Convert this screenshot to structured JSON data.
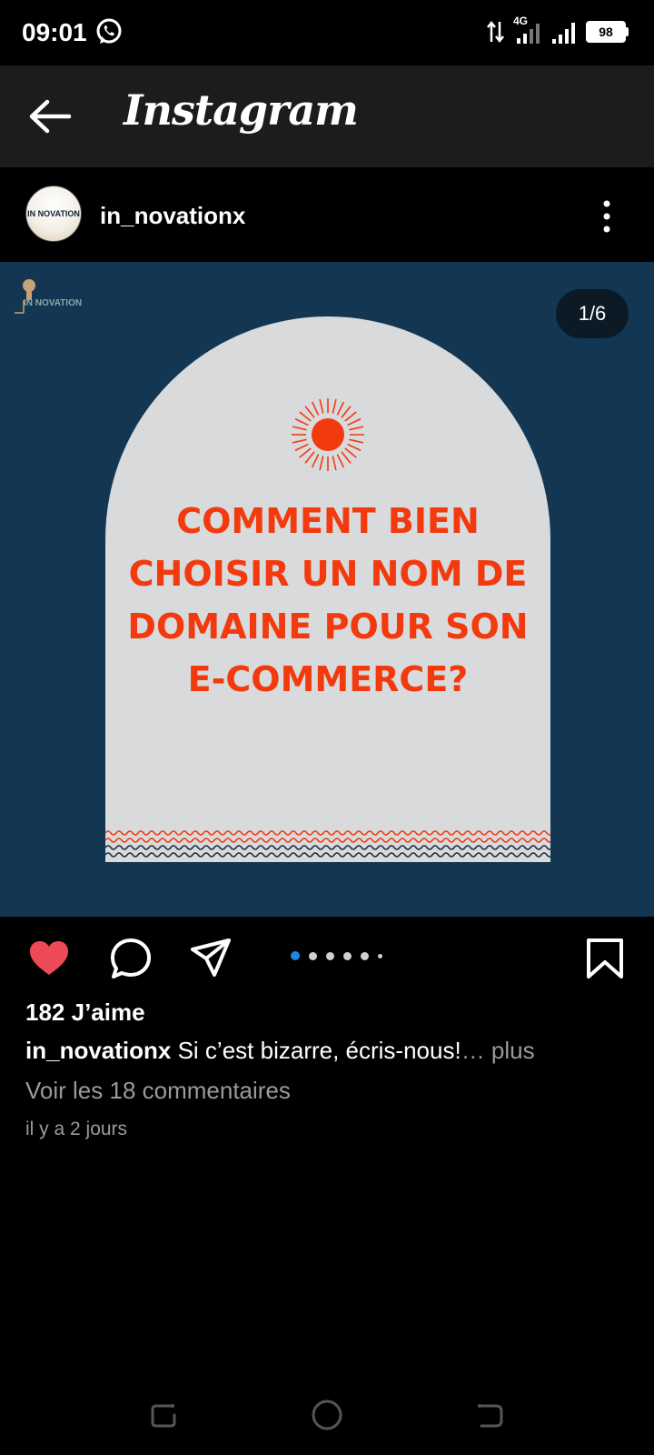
{
  "status_bar": {
    "time": "09:01",
    "network": "4G",
    "battery": "98",
    "icons": [
      "whatsapp-icon",
      "data-arrows-icon",
      "signal-icon",
      "signal-icon",
      "battery-icon"
    ]
  },
  "app_bar": {
    "title": "Instagram",
    "back_icon": "arrow-left-icon"
  },
  "post": {
    "username": "in_novationx",
    "avatar_text": "IN NOVATION",
    "image": {
      "logo_text": "IN NOVATION",
      "counter": "1/6",
      "headline": "COMMENT BIEN CHOISIR UN NOM DE DOMAINE POUR SON E-COMMERCE?",
      "colors": {
        "background": "#133752",
        "arch": "#d8dadc",
        "accent": "#f23a0e"
      }
    },
    "carousel": {
      "count": 6,
      "active": 1
    },
    "likes": "182 J’aime",
    "caption": {
      "user": "in_novationx",
      "text": "Si c’est bizarre, écris-nous!",
      "more": "… plus"
    },
    "comments_link": "Voir les 18 commentaires",
    "time_ago": "il y a 2 jours"
  },
  "colors": {
    "like": "#ed4956",
    "indicator": "#1e88e5"
  }
}
